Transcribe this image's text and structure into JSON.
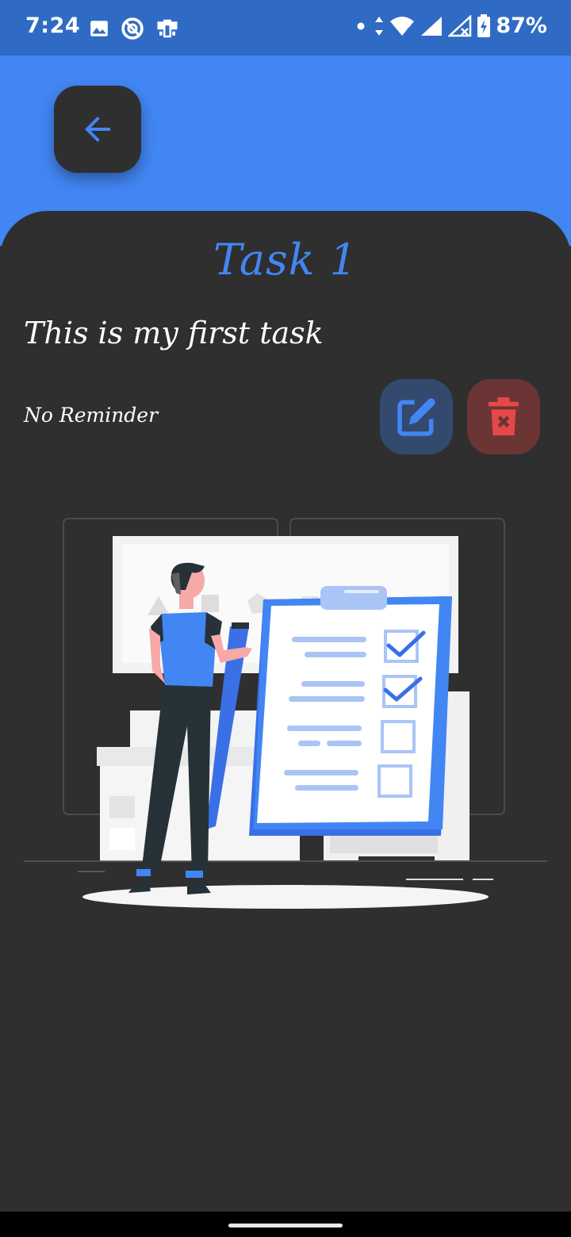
{
  "status_bar": {
    "time": "7:24",
    "battery": "87%",
    "icons": [
      "image-icon",
      "do-not-disturb-icon",
      "work-profile-icon",
      "dot-icon",
      "data-arrows-icon",
      "wifi-icon",
      "signal-icon",
      "signal-no-sim-icon",
      "battery-charging-icon"
    ]
  },
  "header": {
    "back_icon": "arrow-left-icon"
  },
  "task": {
    "title": "Task 1",
    "description": "This is my first task",
    "reminder": "No Reminder"
  },
  "actions": {
    "edit_icon": "edit-icon",
    "delete_icon": "trash-icon"
  },
  "colors": {
    "accent": "#4286f4",
    "status_bar": "#2f6bc4",
    "background": "#2f2f2f",
    "edit_button": "#34496e",
    "delete_button": "#6b3535",
    "delete_icon": "#e64848"
  },
  "illustration": {
    "name": "task-checklist-illustration"
  }
}
